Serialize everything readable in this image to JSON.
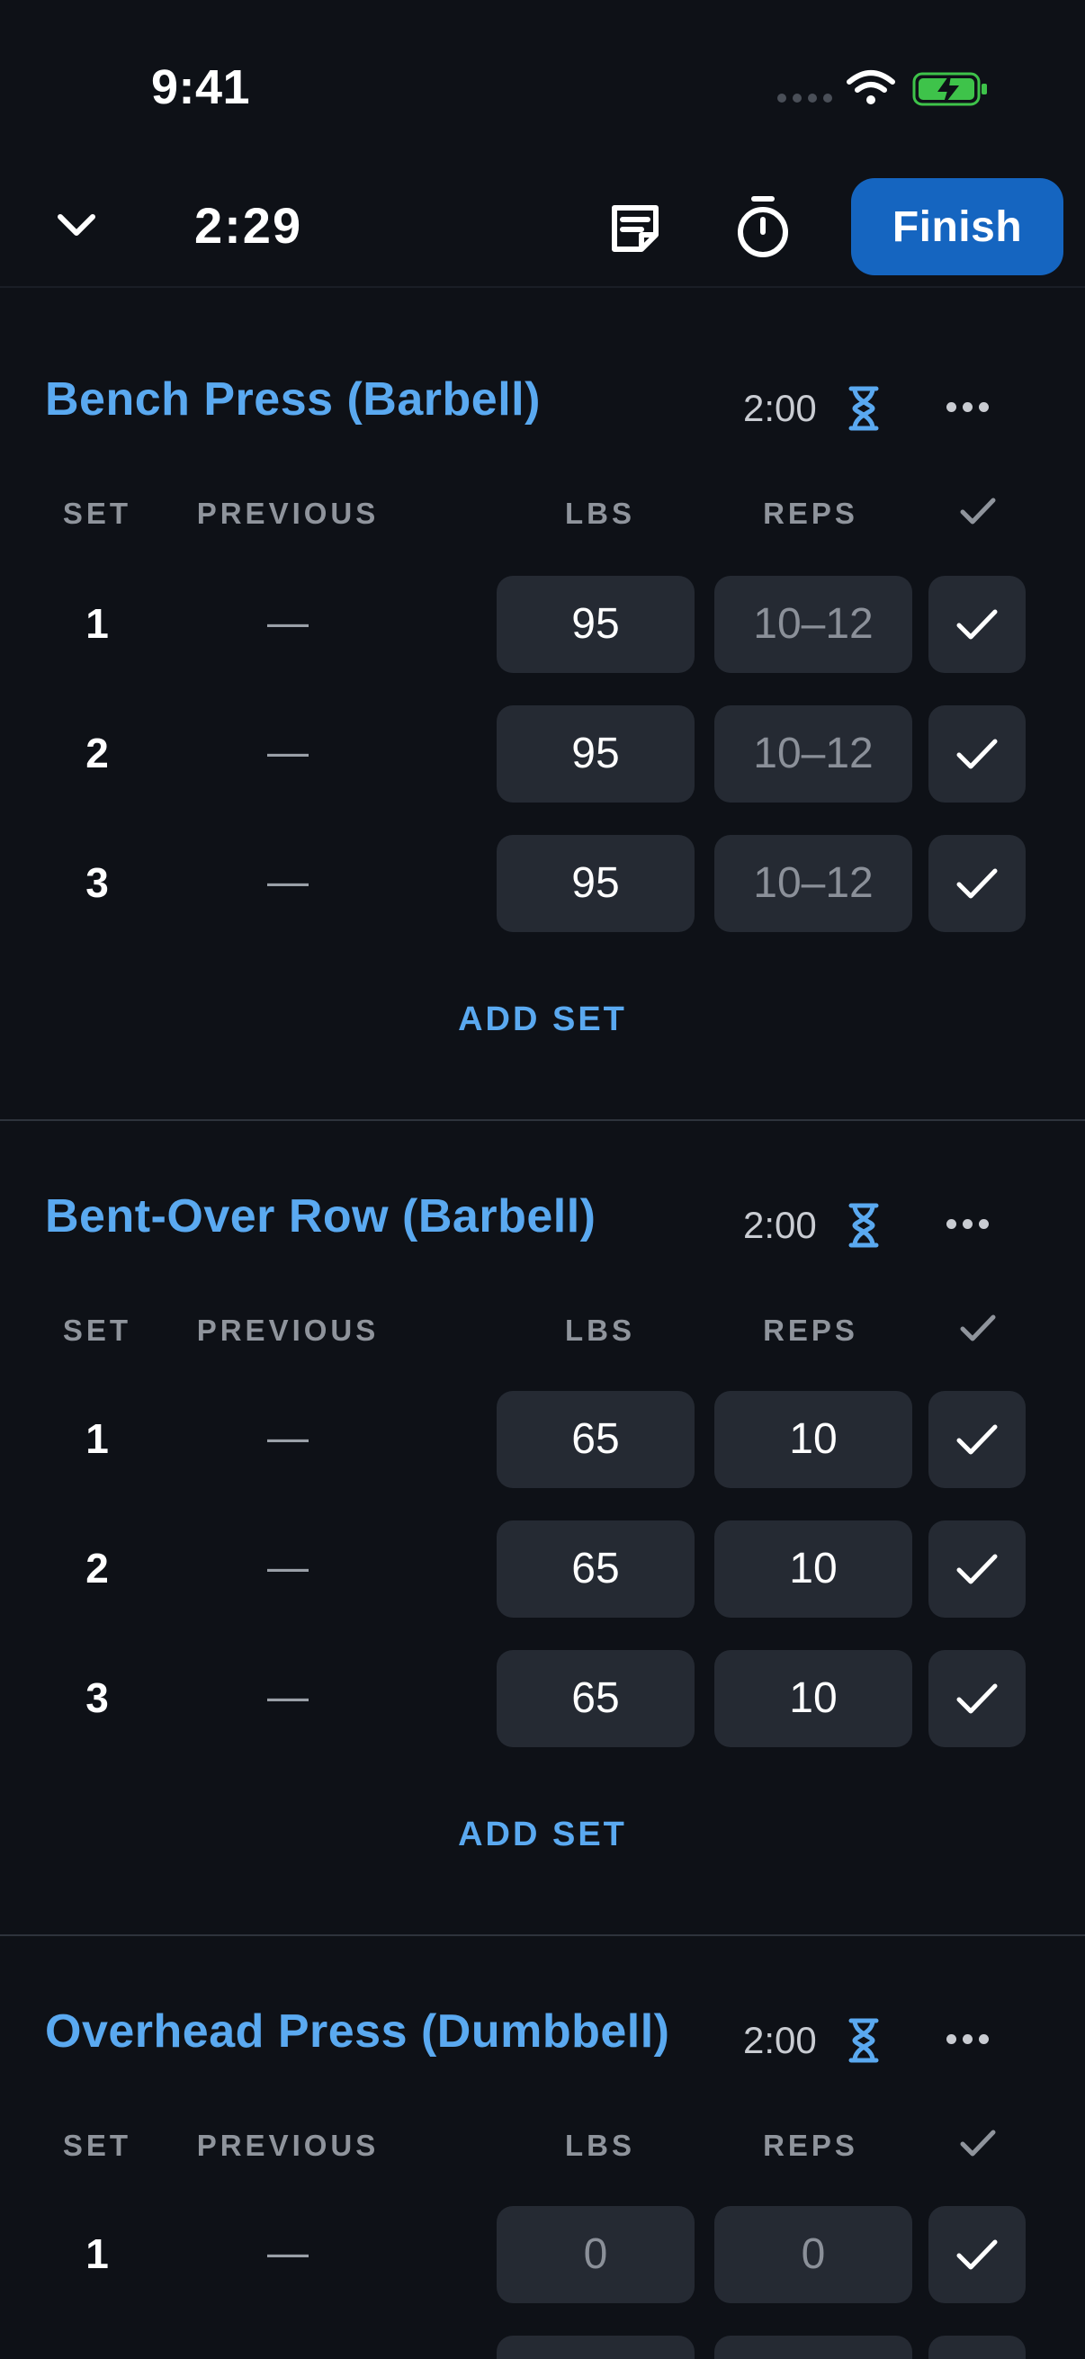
{
  "status_bar": {
    "time": "9:41"
  },
  "header": {
    "elapsed": "2:29",
    "finish_label": "Finish"
  },
  "columns": {
    "set": "SET",
    "previous": "PREVIOUS",
    "lbs": "LBS",
    "reps": "REPS"
  },
  "add_set_label": "ADD SET",
  "colors": {
    "accent": "#5aa9f0",
    "finish": "#1565c0",
    "field": "#252a33",
    "background": "#0e1117",
    "battery": "#3ec34a"
  },
  "exercises": [
    {
      "name": "Bench Press (Barbell)",
      "rest": "2:00",
      "sets": [
        {
          "set": "1",
          "previous": "—",
          "lbs": "95",
          "reps": "10–12"
        },
        {
          "set": "2",
          "previous": "—",
          "lbs": "95",
          "reps": "10–12"
        },
        {
          "set": "3",
          "previous": "—",
          "lbs": "95",
          "reps": "10–12"
        }
      ]
    },
    {
      "name": "Bent-Over Row (Barbell)",
      "rest": "2:00",
      "sets": [
        {
          "set": "1",
          "previous": "—",
          "lbs": "65",
          "reps": "10"
        },
        {
          "set": "2",
          "previous": "—",
          "lbs": "65",
          "reps": "10"
        },
        {
          "set": "3",
          "previous": "—",
          "lbs": "65",
          "reps": "10"
        }
      ]
    },
    {
      "name": "Overhead Press (Dumbbell)",
      "rest": "2:00",
      "sets": [
        {
          "set": "1",
          "previous": "—",
          "lbs": "0",
          "reps": "0"
        }
      ]
    }
  ]
}
